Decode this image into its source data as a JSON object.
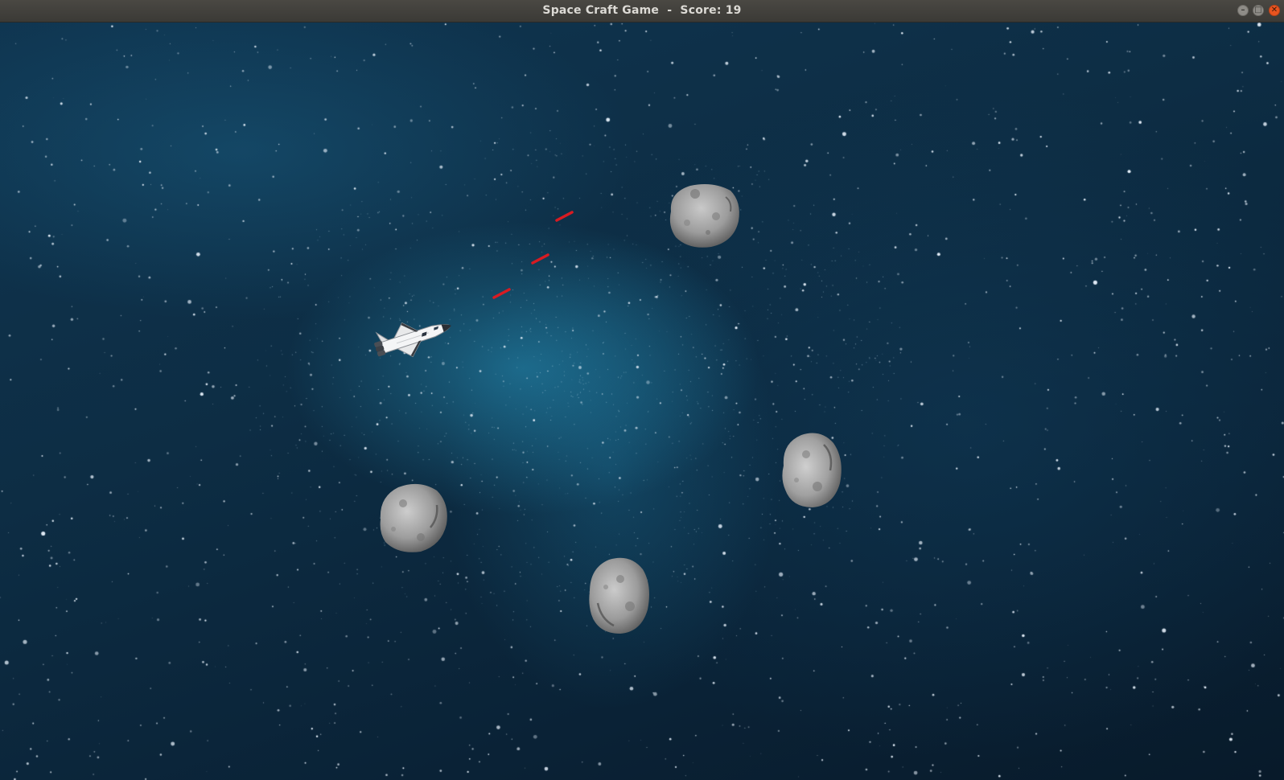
{
  "window": {
    "title": "Space Craft Game  -  Score: 19",
    "controls": {
      "minimize_icon": "minimize-icon",
      "maximize_icon": "maximize-icon",
      "close_icon": "close-icon"
    }
  },
  "game": {
    "score": 19,
    "colors": {
      "laser": "#d81b22",
      "space_dark": "#0a2236",
      "nebula": "#2896be",
      "asteroid": "#9a9a9a"
    },
    "sprites": {
      "player": "space-shuttle",
      "projectile": "laser-bolt",
      "enemy": "asteroid"
    }
  }
}
